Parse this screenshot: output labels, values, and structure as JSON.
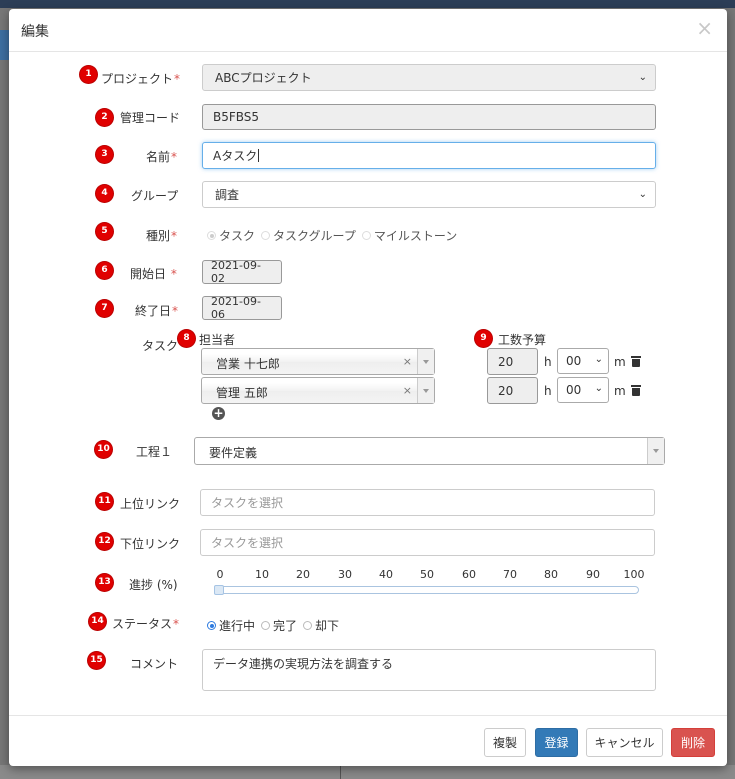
{
  "dialog": {
    "title": "編集",
    "close_glyph": "×"
  },
  "markers": [
    "1",
    "2",
    "3",
    "4",
    "5",
    "6",
    "7",
    "8",
    "9",
    "10",
    "11",
    "12",
    "13",
    "14",
    "15"
  ],
  "required_mark": "*",
  "fields": {
    "project": {
      "label": "プロジェクト",
      "value": "ABCプロジェクト"
    },
    "code": {
      "label": "管理コード",
      "value": "B5FBS5"
    },
    "name": {
      "label": "名前",
      "value": "Aタスク"
    },
    "group": {
      "label": "グループ",
      "value": "調査"
    },
    "kind": {
      "label": "種別",
      "options": [
        "タスク",
        "タスクグループ",
        "マイルストーン"
      ],
      "selected": "タスク"
    },
    "start_date": {
      "label": "開始日",
      "value": "2021-09-02"
    },
    "end_date": {
      "label": "終了日",
      "value": "2021-09-06"
    },
    "task": {
      "label": "タスク",
      "assignee_header": "担当者",
      "budget_header": "工数予算",
      "rows": [
        {
          "assignee": "営業 十七郎",
          "hours": "20",
          "hours_unit": "h",
          "minutes": "00",
          "minutes_unit": "m"
        },
        {
          "assignee": "管理 五郎",
          "hours": "20",
          "hours_unit": "h",
          "minutes": "00",
          "minutes_unit": "m"
        }
      ],
      "remove_glyph": "×"
    },
    "process": {
      "label": "工程１",
      "value": "要件定義"
    },
    "parent_link": {
      "label": "上位リンク",
      "placeholder": "タスクを選択"
    },
    "child_link": {
      "label": "下位リンク",
      "placeholder": "タスクを選択"
    },
    "progress": {
      "label": "進捗 (%)",
      "ticks": [
        "0",
        "10",
        "20",
        "30",
        "40",
        "50",
        "60",
        "70",
        "80",
        "90",
        "100"
      ],
      "value": 0
    },
    "status": {
      "label": "ステータス",
      "options": [
        "進行中",
        "完了",
        "却下"
      ],
      "selected": "進行中"
    },
    "comment": {
      "label": "コメント",
      "value": "データ連携の実現方法を調査する"
    }
  },
  "footer": {
    "duplicate": "複製",
    "register": "登録",
    "cancel": "キャンセル",
    "delete": "削除"
  },
  "colors": {
    "marker": "#e00000",
    "primary": "#337ab7",
    "danger": "#d9534f",
    "required": "#d9534f"
  }
}
